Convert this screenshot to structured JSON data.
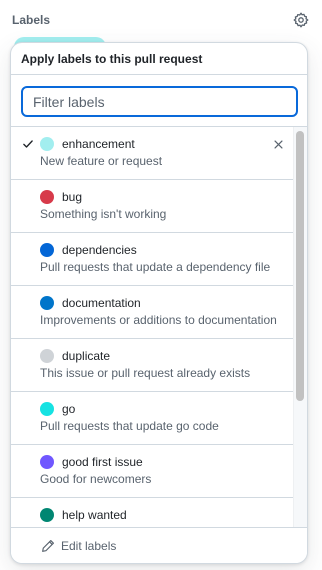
{
  "sidebar": {
    "title": "Labels",
    "gear_icon": "gear-icon"
  },
  "popover": {
    "title": "Apply labels to this pull request",
    "filter": {
      "placeholder": "Filter labels",
      "value": ""
    },
    "footer": {
      "label": "Edit labels",
      "icon": "pencil-icon"
    },
    "labels": [
      {
        "name": "enhancement",
        "description": "New feature or request",
        "color": "#a2eeef",
        "selected": true
      },
      {
        "name": "bug",
        "description": "Something isn't working",
        "color": "#d73a4a",
        "selected": false
      },
      {
        "name": "dependencies",
        "description": "Pull requests that update a dependency file",
        "color": "#0366d6",
        "selected": false
      },
      {
        "name": "documentation",
        "description": "Improvements or additions to documentation",
        "color": "#0075ca",
        "selected": false
      },
      {
        "name": "duplicate",
        "description": "This issue or pull request already exists",
        "color": "#cfd3d7",
        "selected": false
      },
      {
        "name": "go",
        "description": "Pull requests that update go code",
        "color": "#16e2e2",
        "selected": false
      },
      {
        "name": "good first issue",
        "description": "Good for newcomers",
        "color": "#7057ff",
        "selected": false
      },
      {
        "name": "help wanted",
        "description": "",
        "color": "#008672",
        "selected": false
      }
    ]
  },
  "colors": {
    "accent": "#0969da",
    "border": "#d1d9e0",
    "muted_text": "#59636e"
  }
}
